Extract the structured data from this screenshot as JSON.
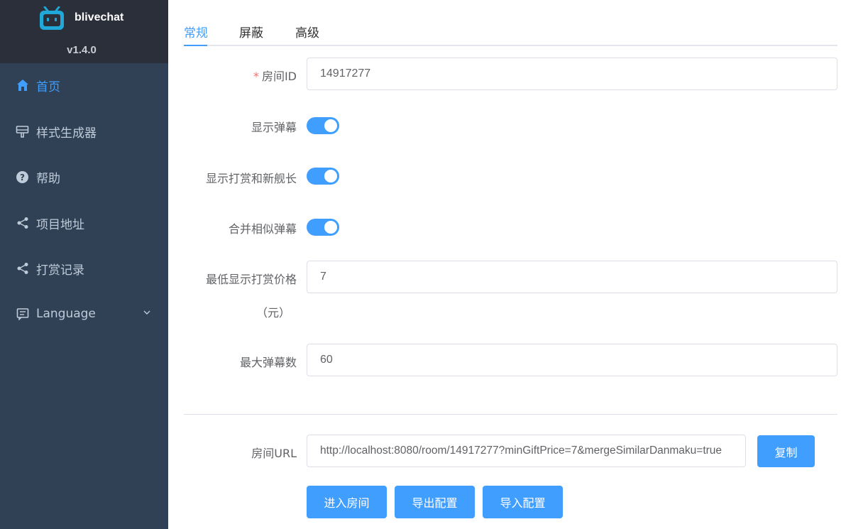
{
  "app": {
    "name": "blivechat",
    "version": "v1.4.0"
  },
  "sidebar": {
    "items": [
      {
        "label": "首页",
        "icon": "home-icon",
        "active": true
      },
      {
        "label": "样式生成器",
        "icon": "brush-icon",
        "active": false
      },
      {
        "label": "帮助",
        "icon": "question-icon",
        "active": false
      },
      {
        "label": "项目地址",
        "icon": "share-icon",
        "active": false
      },
      {
        "label": "打赏记录",
        "icon": "share-icon",
        "active": false
      },
      {
        "label": "Language",
        "icon": "chat-icon",
        "active": false
      }
    ]
  },
  "tabs": [
    {
      "label": "常规",
      "active": true
    },
    {
      "label": "屏蔽",
      "active": false
    },
    {
      "label": "高级",
      "active": false
    }
  ],
  "form": {
    "room_id": {
      "label": "房间ID",
      "required_mark": "*",
      "value": "14917277"
    },
    "show_danmaku": {
      "label": "显示弹幕",
      "on": true
    },
    "show_gift": {
      "label": "显示打赏和新舰长",
      "on": true
    },
    "merge_similar": {
      "label": "合并相似弹幕",
      "on": true
    },
    "min_gift_price": {
      "label_line1": "最低显示打赏价格",
      "label_line2": "（元）",
      "value": "7"
    },
    "max_danmaku": {
      "label": "最大弹幕数",
      "value": "60"
    },
    "room_url": {
      "label": "房间URL",
      "value": "http://localhost:8080/room/14917277?minGiftPrice=7&mergeSimilarDanmaku=true"
    }
  },
  "buttons": {
    "copy": "复制",
    "enter_room": "进入房间",
    "export_config": "导出配置",
    "import_config": "导入配置"
  },
  "colors": {
    "primary": "#409eff",
    "sidebar_bg": "#304156",
    "brand_bg": "#2b2f3a",
    "menu_text": "#bfcbd9",
    "required": "#f56c6c"
  }
}
